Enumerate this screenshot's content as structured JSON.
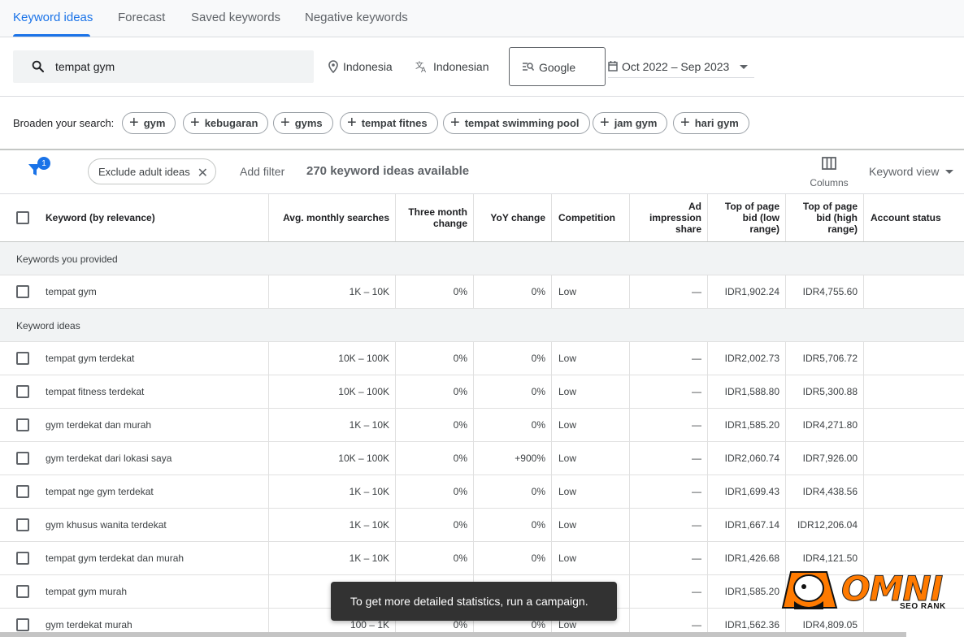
{
  "tabs": {
    "items": [
      "Keyword ideas",
      "Forecast",
      "Saved keywords",
      "Negative keywords"
    ],
    "active": "Keyword ideas"
  },
  "search": {
    "query": "tempat gym",
    "location": "Indonesia",
    "language": "Indonesian",
    "network": "Google",
    "date_range": "Oct 2022 – Sep 2023"
  },
  "broaden": {
    "label": "Broaden your search:",
    "chips": [
      "gym",
      "kebugaran",
      "gyms",
      "tempat fitnes",
      "tempat swimming pool",
      "jam gym",
      "hari gym"
    ]
  },
  "filter_bar": {
    "filter_count": "1",
    "exclude_chip": "Exclude adult ideas",
    "add_filter": "Add filter",
    "ideas_count": "270 keyword ideas available",
    "columns_label": "Columns",
    "view_label": "Keyword view"
  },
  "table": {
    "headers": {
      "keyword": "Keyword (by relevance)",
      "avg": "Avg. monthly searches",
      "three_month_1": "Three month",
      "three_month_2": "change",
      "yoy": "YoY change",
      "competition": "Competition",
      "ad_share_1": "Ad impression",
      "ad_share_2": "share",
      "top_low_1": "Top of page",
      "top_low_2": "bid (low",
      "top_low_3": "range)",
      "top_high_1": "Top of page",
      "top_high_2": "bid (high",
      "top_high_3": "range)",
      "account": "Account status"
    },
    "provided_section": "Keywords you provided",
    "provided": [
      {
        "keyword": "tempat gym",
        "avg": "1K – 10K",
        "three": "0%",
        "yoy": "0%",
        "comp": "Low",
        "share": "—",
        "low": "IDR1,902.24",
        "high": "IDR4,755.60"
      }
    ],
    "ideas_section": "Keyword ideas",
    "ideas": [
      {
        "keyword": "tempat gym terdekat",
        "avg": "10K – 100K",
        "three": "0%",
        "yoy": "0%",
        "comp": "Low",
        "share": "—",
        "low": "IDR2,002.73",
        "high": "IDR5,706.72"
      },
      {
        "keyword": "tempat fitness terdekat",
        "avg": "10K – 100K",
        "three": "0%",
        "yoy": "0%",
        "comp": "Low",
        "share": "—",
        "low": "IDR1,588.80",
        "high": "IDR5,300.88"
      },
      {
        "keyword": "gym terdekat dan murah",
        "avg": "1K – 10K",
        "three": "0%",
        "yoy": "0%",
        "comp": "Low",
        "share": "—",
        "low": "IDR1,585.20",
        "high": "IDR4,271.80"
      },
      {
        "keyword": "gym terdekat dari lokasi saya",
        "avg": "10K – 100K",
        "three": "0%",
        "yoy": "+900%",
        "comp": "Low",
        "share": "—",
        "low": "IDR2,060.74",
        "high": "IDR7,926.00"
      },
      {
        "keyword": "tempat nge gym terdekat",
        "avg": "1K – 10K",
        "three": "0%",
        "yoy": "0%",
        "comp": "Low",
        "share": "—",
        "low": "IDR1,699.43",
        "high": "IDR4,438.56"
      },
      {
        "keyword": "gym khusus wanita terdekat",
        "avg": "1K – 10K",
        "three": "0%",
        "yoy": "0%",
        "comp": "Low",
        "share": "—",
        "low": "IDR1,667.14",
        "high": "IDR12,206.04"
      },
      {
        "keyword": "tempat gym terdekat dan murah",
        "avg": "1K – 10K",
        "three": "0%",
        "yoy": "0%",
        "comp": "Low",
        "share": "—",
        "low": "IDR1,426.68",
        "high": "IDR4,121.50"
      },
      {
        "keyword": "tempat gym murah",
        "avg": "",
        "three": "",
        "yoy": "",
        "comp": "",
        "share": "—",
        "low": "IDR1,585.20",
        "high": ""
      },
      {
        "keyword": "gym terdekat murah",
        "avg": "100 – 1K",
        "three": "0%",
        "yoy": "0%",
        "comp": "Low",
        "share": "—",
        "low": "IDR1,562.36",
        "high": "IDR4,809.05"
      }
    ]
  },
  "snackbar": "To get more detailed statistics, run a campaign.",
  "watermark": {
    "word": "OMNI",
    "sub": "SEO RANK"
  },
  "colors": {
    "accent": "#1a73e8",
    "brand_orange": "#ff7a00"
  }
}
